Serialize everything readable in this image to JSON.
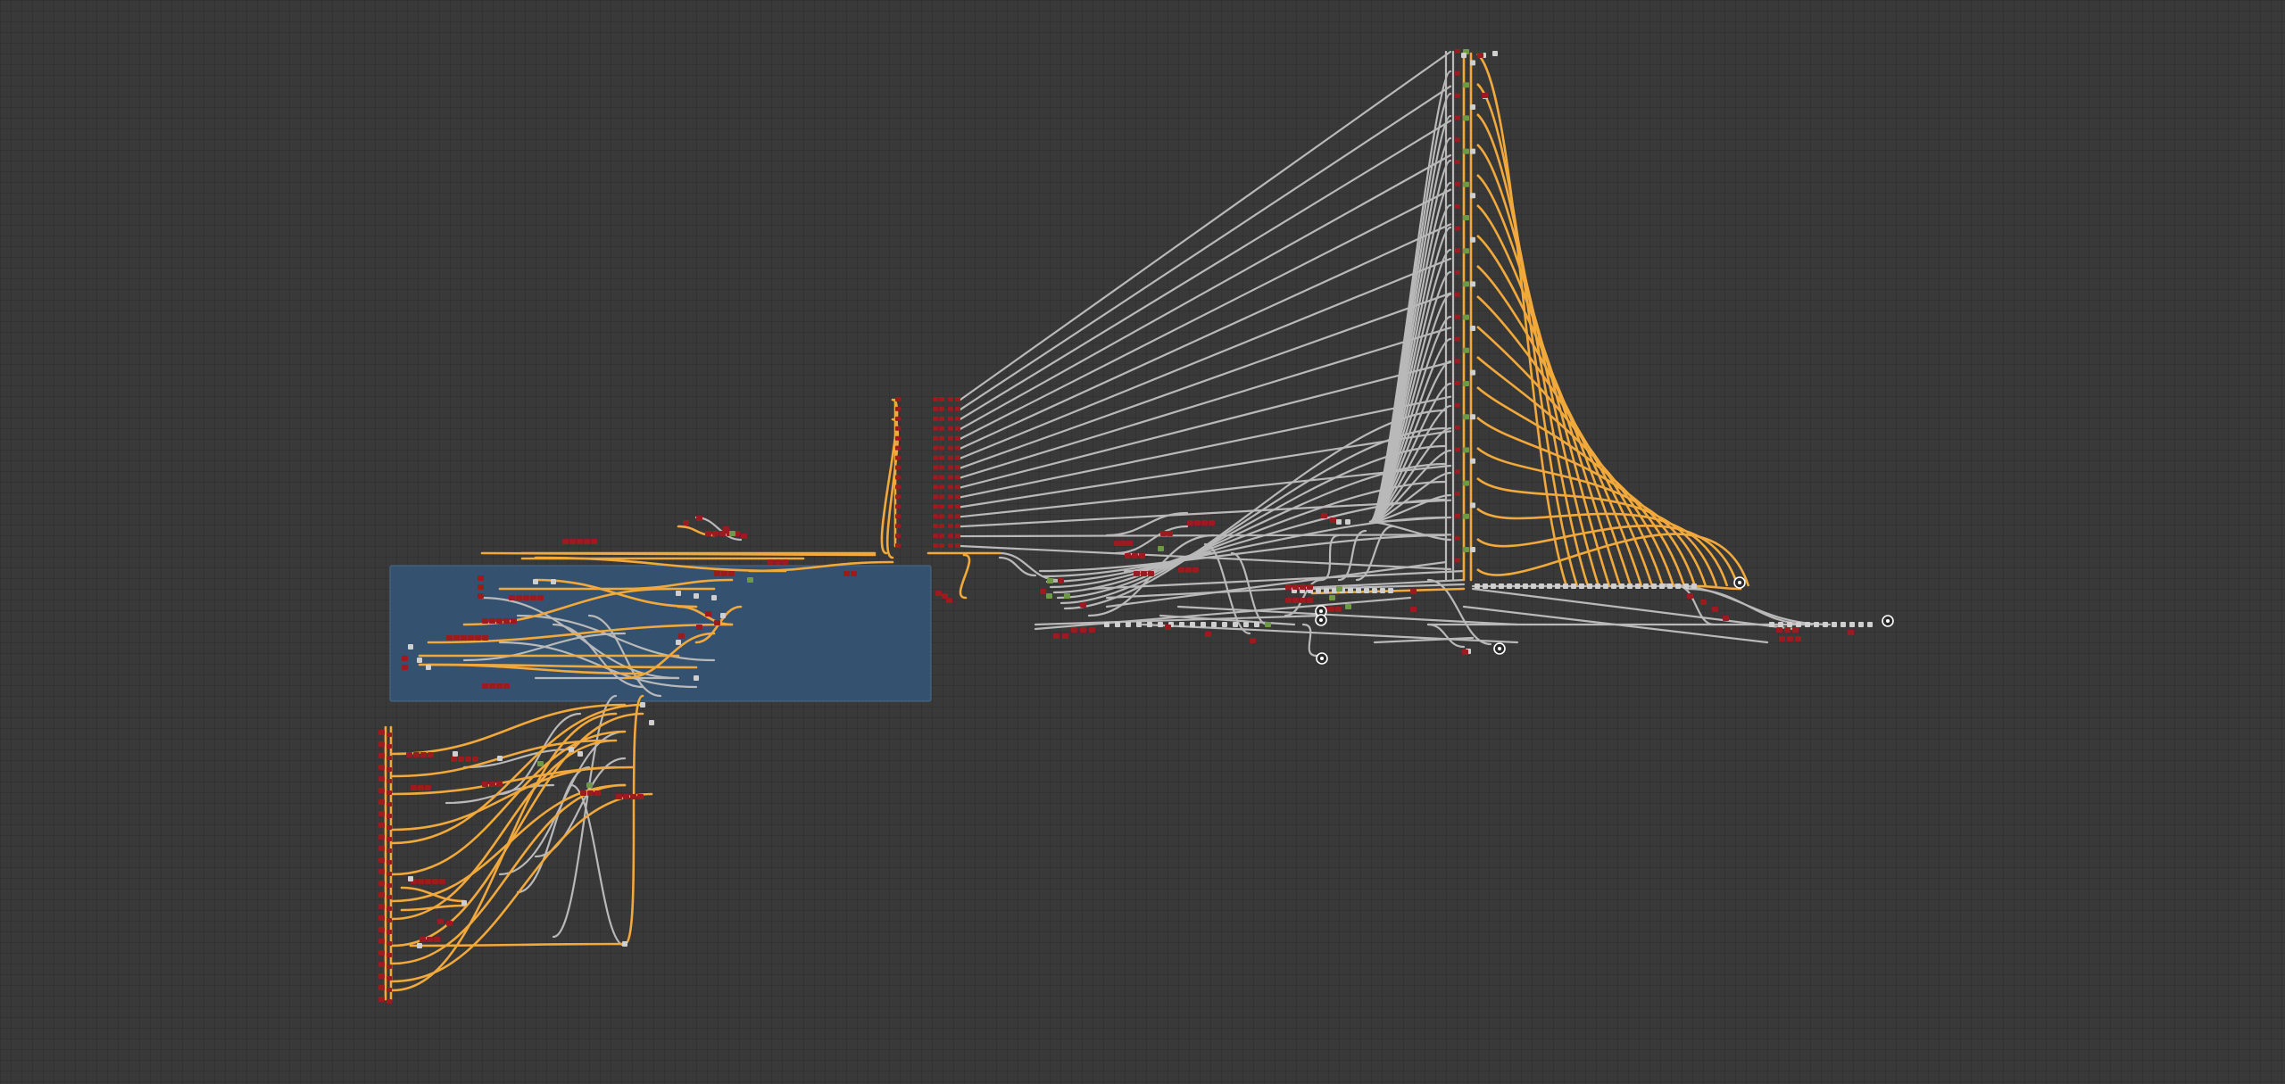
{
  "editor": {
    "type": "node-graph",
    "frame": {
      "label": ""
    },
    "colors": {
      "background": "#393939",
      "frame_fill": "#34516f",
      "frame_border": "#4a6a8c",
      "wire_orange": "#f2a93b",
      "wire_grey": "#b9b9b9",
      "node_red": "#9b1b1e",
      "node_grey": "#cfcfcf",
      "node_green": "#6e9a45",
      "output_ring": "#ffffff"
    },
    "icons": {
      "data_node": "red-block",
      "reroute": "grey-square",
      "output": "ring-icon"
    }
  }
}
